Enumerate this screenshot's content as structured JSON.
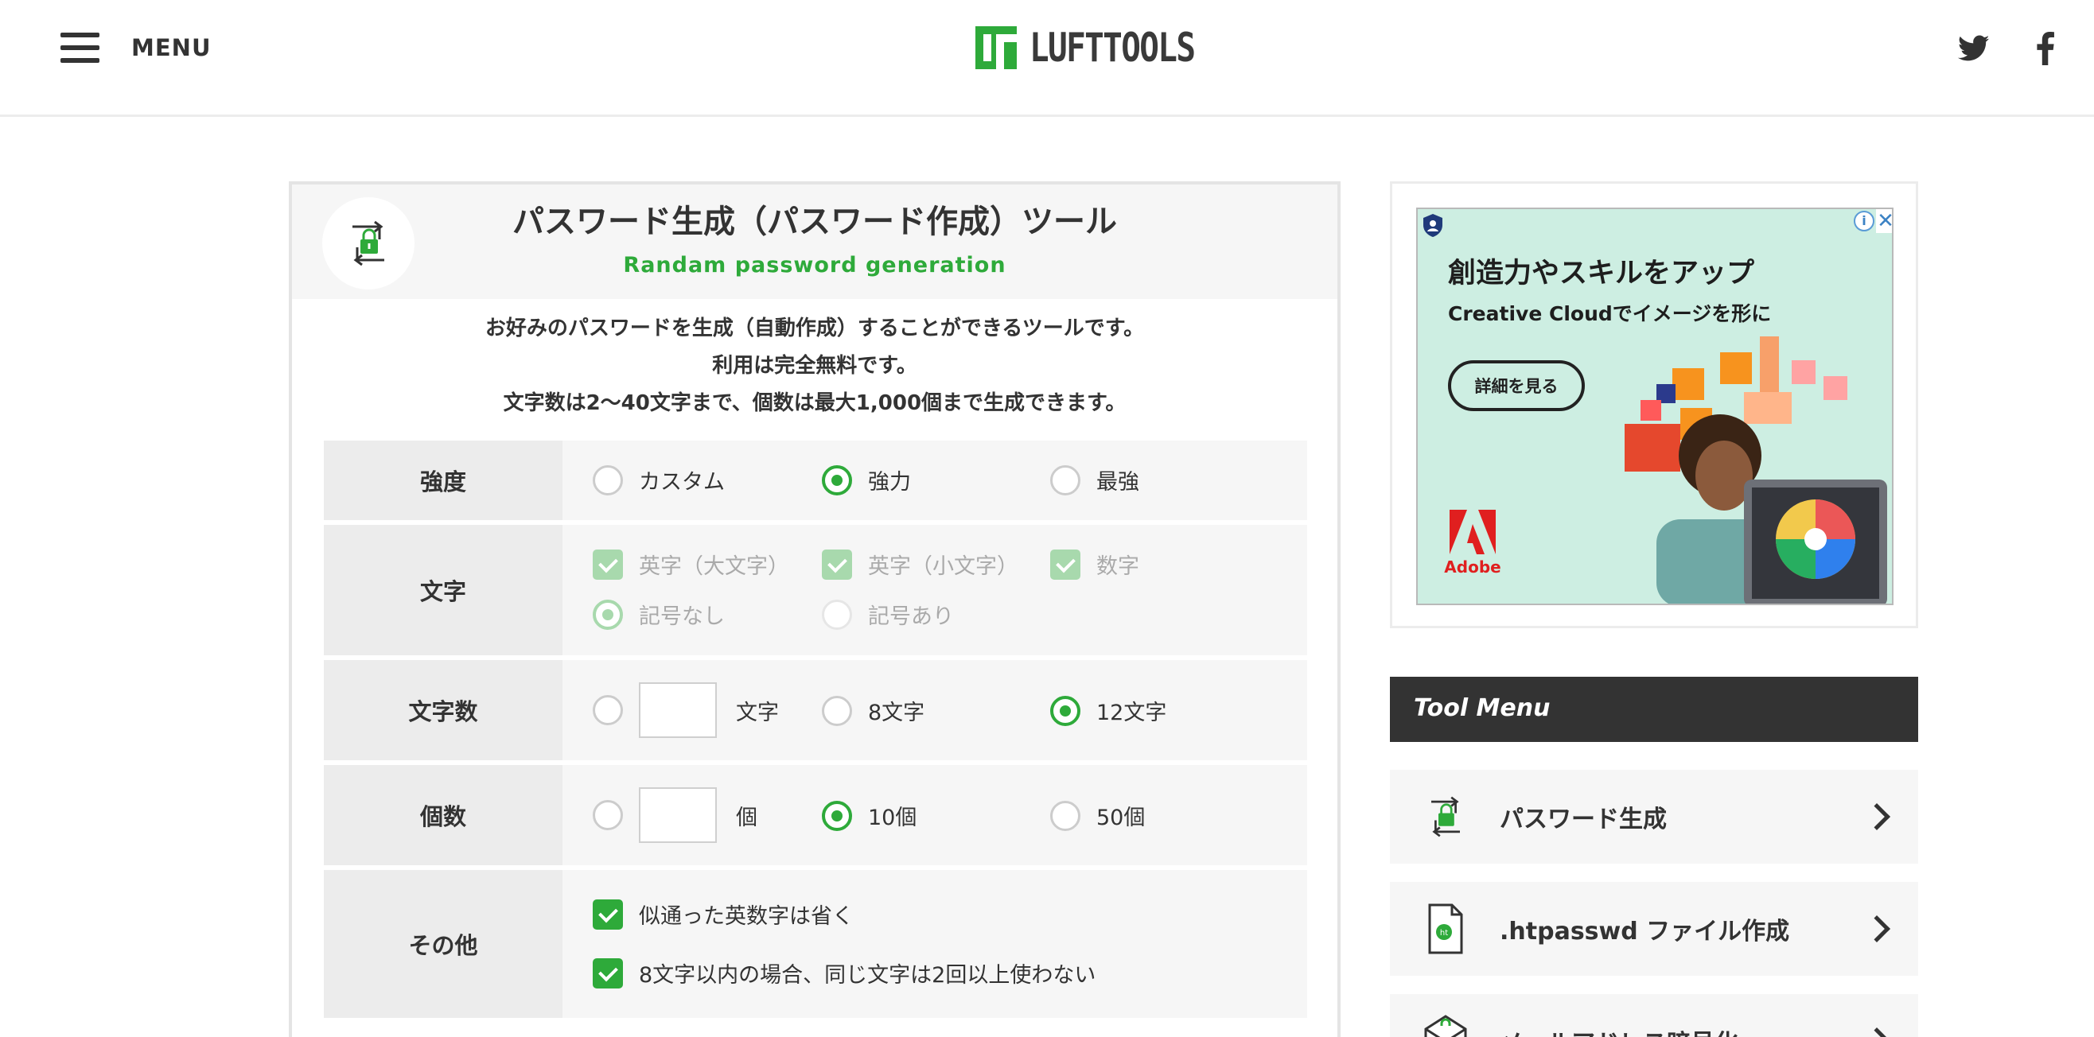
{
  "header": {
    "menu_label": "MENU",
    "logo_text": "LUFTTOOLS",
    "social": [
      "twitter-icon",
      "facebook-icon"
    ]
  },
  "tool": {
    "title": "パスワード生成（パスワード作成）ツール",
    "subtitle": "Randam password generation",
    "description": [
      "お好みのパスワードを生成（自動作成）することができるツールです。",
      "利用は完全無料です。",
      "文字数は2〜40文字まで、個数は最大1,000個まで生成できます。"
    ],
    "rows": {
      "strength": {
        "label": "強度",
        "options": [
          "カスタム",
          "強力",
          "最強"
        ],
        "selected": "強力"
      },
      "chars": {
        "label": "文字",
        "checkboxes": [
          "英字（大文字）",
          "英字（小文字）",
          "数字"
        ],
        "symbol_options": [
          "記号なし",
          "記号あり"
        ],
        "symbol_selected": "記号なし",
        "disabled": true
      },
      "length": {
        "label": "文字数",
        "custom_unit": "文字",
        "options": [
          "8文字",
          "12文字"
        ],
        "selected": "12文字",
        "custom_value": ""
      },
      "count": {
        "label": "個数",
        "custom_unit": "個",
        "options": [
          "10個",
          "50個"
        ],
        "selected": "10個",
        "custom_value": ""
      },
      "other": {
        "label": "その他",
        "checkboxes": [
          "似通った英数字は省く",
          "8文字以内の場合、同じ文字は2回以上使わない"
        ]
      }
    }
  },
  "ad": {
    "headline": "創造力やスキルをアップ",
    "subline": "Creative Cloudでイメージを形に",
    "cta": "詳細を見る",
    "brand": "Adobe",
    "info_glyph": "i",
    "close_glyph": "✕"
  },
  "tool_menu": {
    "heading": "Tool Menu",
    "items": [
      {
        "label": "パスワード生成",
        "icon": "password-lock-icon"
      },
      {
        "label": ".htpasswd ファイル作成",
        "icon": "htpasswd-file-icon"
      },
      {
        "label": "メールアドレス暗号化",
        "icon": "mail-lock-icon"
      }
    ]
  },
  "colors": {
    "accent": "#2eaa3a",
    "accent_disabled": "#a8d9ad",
    "dark": "#333333",
    "panel_bg": "#f6f6f6",
    "label_bg": "#ececec",
    "ad_bg": "#cdeee2"
  }
}
